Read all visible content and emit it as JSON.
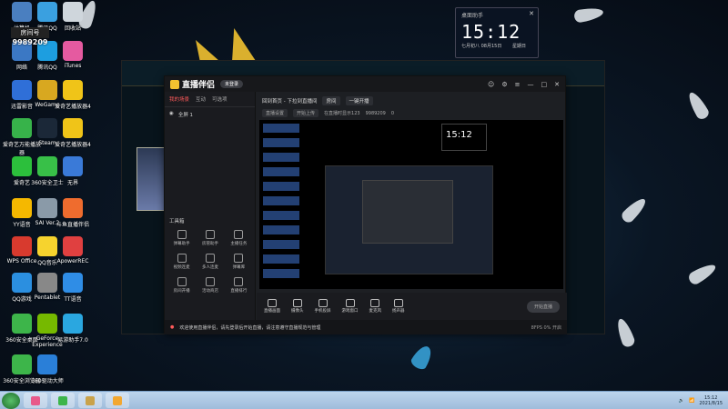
{
  "desktop": {
    "icons": [
      {
        "label": "计算机",
        "color": "#4a7fc0"
      },
      {
        "label": "腾讯QQ",
        "color": "#3aa0e0"
      },
      {
        "label": "回收站",
        "color": "#cfd6dc"
      },
      {
        "label": "网络",
        "color": "#3b78c4"
      },
      {
        "label": "腾讯QQ",
        "color": "#1d9ee0"
      },
      {
        "label": "iTunes",
        "color": "#e55aa0"
      },
      {
        "label": "迅雷影音",
        "color": "#2f6fd8"
      },
      {
        "label": "WeGame",
        "color": "#d8a820"
      },
      {
        "label": "爱奇艺播放器4",
        "color": "#f0c418"
      },
      {
        "label": "爱奇艺万能播放器",
        "color": "#37b34a"
      },
      {
        "label": "Steam",
        "color": "#1b2838"
      },
      {
        "label": "爱奇艺播放器4",
        "color": "#f0c418"
      },
      {
        "label": "爱奇艺",
        "color": "#2cbf3c"
      },
      {
        "label": "360安全卫士",
        "color": "#38c048"
      },
      {
        "label": "无界",
        "color": "#3a7ad8"
      },
      {
        "label": "YY语音",
        "color": "#f5b800"
      },
      {
        "label": "SAI Ver.2",
        "color": "#8a9aa8"
      },
      {
        "label": "斗鱼直播伴侣",
        "color": "#ef6c2e"
      },
      {
        "label": "WPS Office",
        "color": "#d83a2e"
      },
      {
        "label": "QQ音乐",
        "color": "#f6d32e"
      },
      {
        "label": "ApowerREC",
        "color": "#e04040"
      },
      {
        "label": "QQ游戏",
        "color": "#2b8fe0"
      },
      {
        "label": "Pentablet",
        "color": "#888"
      },
      {
        "label": "TT语音",
        "color": "#2f8de6"
      },
      {
        "label": "360安全桌面",
        "color": "#3db54a"
      },
      {
        "label": "GeForce Experience",
        "color": "#76b900"
      },
      {
        "label": "易游助手7.0",
        "color": "#2aa7e0"
      },
      {
        "label": "360安全浏览器",
        "color": "#3db54a"
      },
      {
        "label": "360驱动大师",
        "color": "#2a7fd8"
      }
    ],
    "room_label": "房间号",
    "room_number": "9989209"
  },
  "clock_widget": {
    "label": "桌面助手",
    "close": "✕",
    "time": "15:12",
    "date": "七月初八   08月15日",
    "weekday": "星期日"
  },
  "app": {
    "title": "直播伴侣",
    "login_label": "未登录",
    "win_controls": [
      "☺",
      "⚙",
      "≡",
      "—",
      "□",
      "✕"
    ],
    "tabs": [
      {
        "label": "我的场景",
        "active": true
      },
      {
        "label": "互动",
        "active": false
      },
      {
        "label": "可选项",
        "active": false
      }
    ],
    "scene_label": "全屏 1",
    "tools_title": "工具箱",
    "tools": [
      "弹幕助手",
      "房管助手",
      "主播任务",
      "视频连麦",
      "多人连麦",
      "弹幕库",
      "房间开播",
      "活动商店",
      "直播排行",
      "弹幕助手",
      "直播音乐",
      "更多工具"
    ],
    "header_row1": [
      "回到首页 - 下拉到直播间",
      "房间",
      "一键开播"
    ],
    "header_row2": [
      "直播设置",
      "开始上传",
      "在直播时显示123",
      "9989209",
      "0"
    ],
    "bottom_items": [
      "直播画面",
      "摄像头",
      "手机投屏",
      "游戏窗口",
      "麦克风",
      "扬声器"
    ],
    "start_live_label": "开始直播",
    "status_text": "欢迎使用直播伴侣，请先登录后开始直播，请注意遵守直播规范与管理",
    "status_right": "8FPS  0%  开启"
  },
  "taskbar": {
    "apps": [
      {
        "name": "media-app",
        "color": "#e85a8a"
      },
      {
        "name": "360-app",
        "color": "#3db54a"
      },
      {
        "name": "game-client",
        "color": "#c9a24a"
      },
      {
        "name": "streaming-app",
        "color": "#f2a730"
      }
    ],
    "tray_time": "15:12",
    "tray_date": "2021/8/15"
  }
}
